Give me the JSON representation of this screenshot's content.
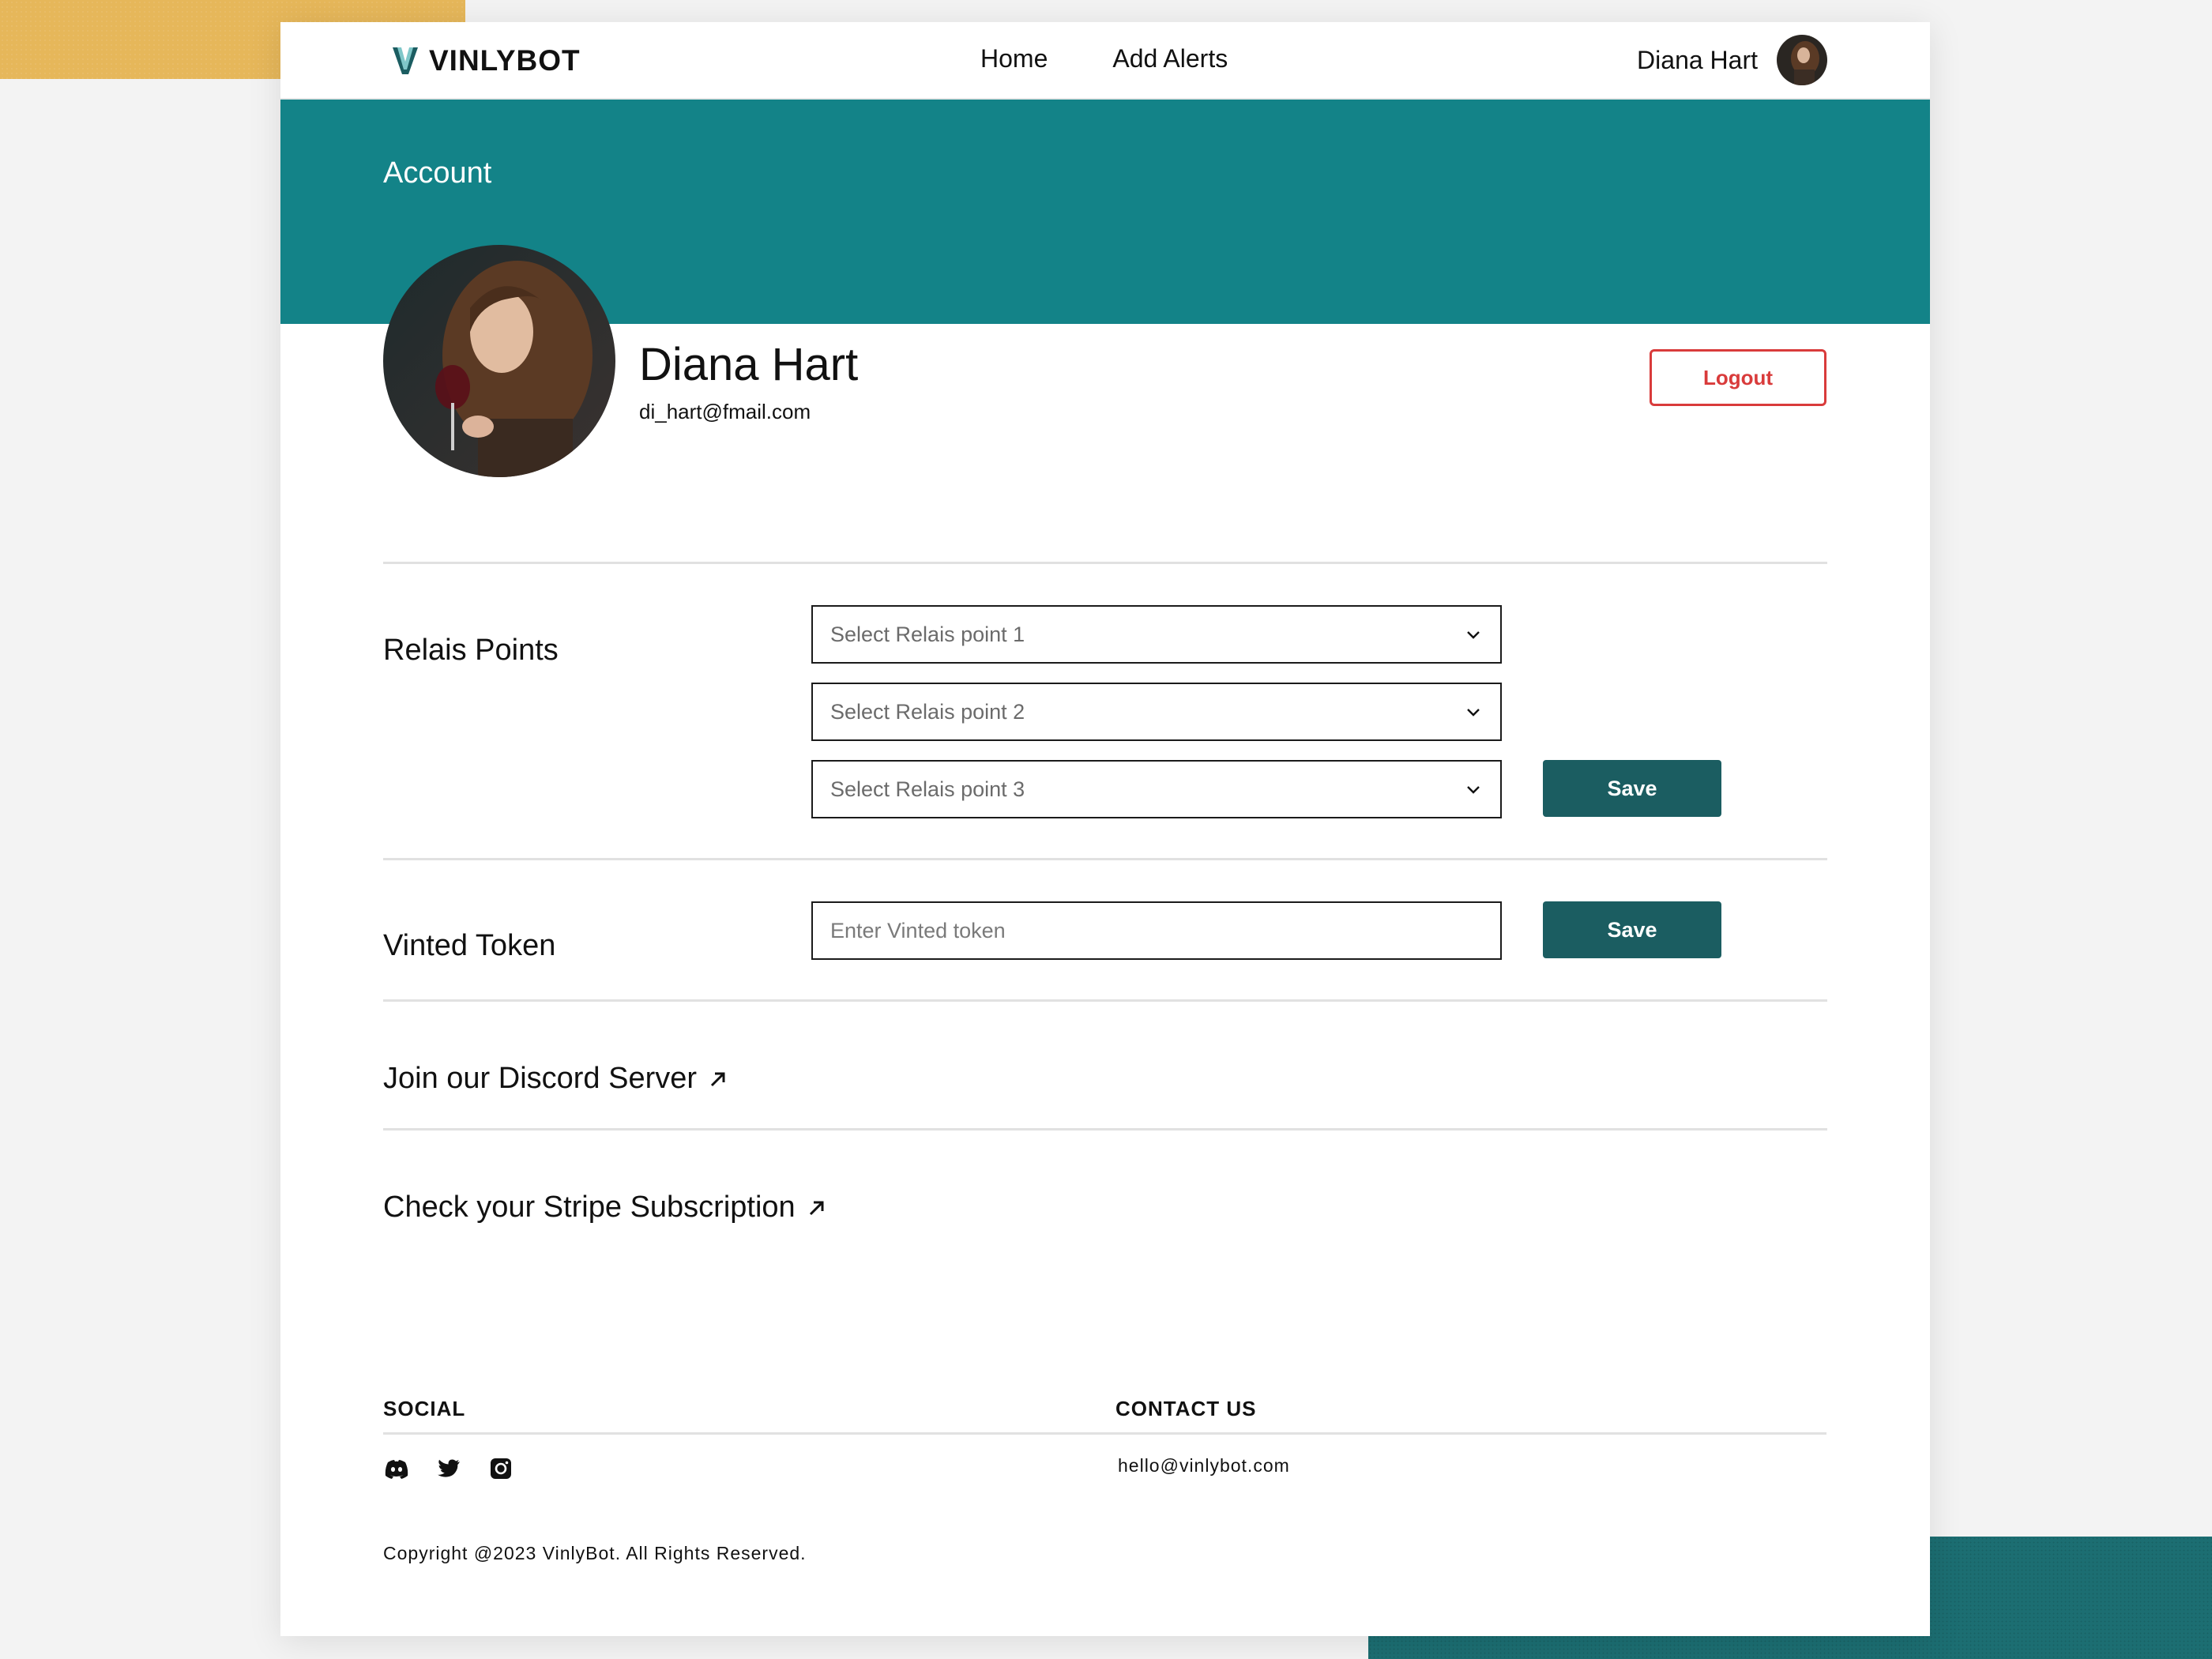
{
  "brand": {
    "name": "VINLYBOT"
  },
  "nav": {
    "links": [
      "Home",
      "Add Alerts"
    ],
    "user_name": "Diana Hart"
  },
  "banner": {
    "title": "Account"
  },
  "profile": {
    "name": "Diana Hart",
    "email": "di_hart@fmail.com",
    "logout_label": "Logout"
  },
  "relais": {
    "label": "Relais Points",
    "selects": [
      {
        "value": "Select Relais point 1"
      },
      {
        "value": "Select Relais point 2"
      },
      {
        "value": "Select Relais point 3"
      }
    ],
    "save_label": "Save"
  },
  "vinted": {
    "label": "Vinted Token",
    "placeholder": "Enter Vinted token",
    "save_label": "Save"
  },
  "links": {
    "discord": "Join our Discord Server",
    "stripe": "Check your Stripe Subscription"
  },
  "footer": {
    "social_heading": "SOCIAL",
    "contact_heading": "CONTACT US",
    "contact_email": "hello@vinlybot.com",
    "social_icons": [
      "discord-icon",
      "twitter-icon",
      "instagram-icon"
    ],
    "copyright": "Copyright @2023 VinlyBot. All Rights Reserved."
  },
  "colors": {
    "accent_teal": "#138388",
    "button_teal": "#1b5d61",
    "logout_red": "#d93b3b"
  }
}
